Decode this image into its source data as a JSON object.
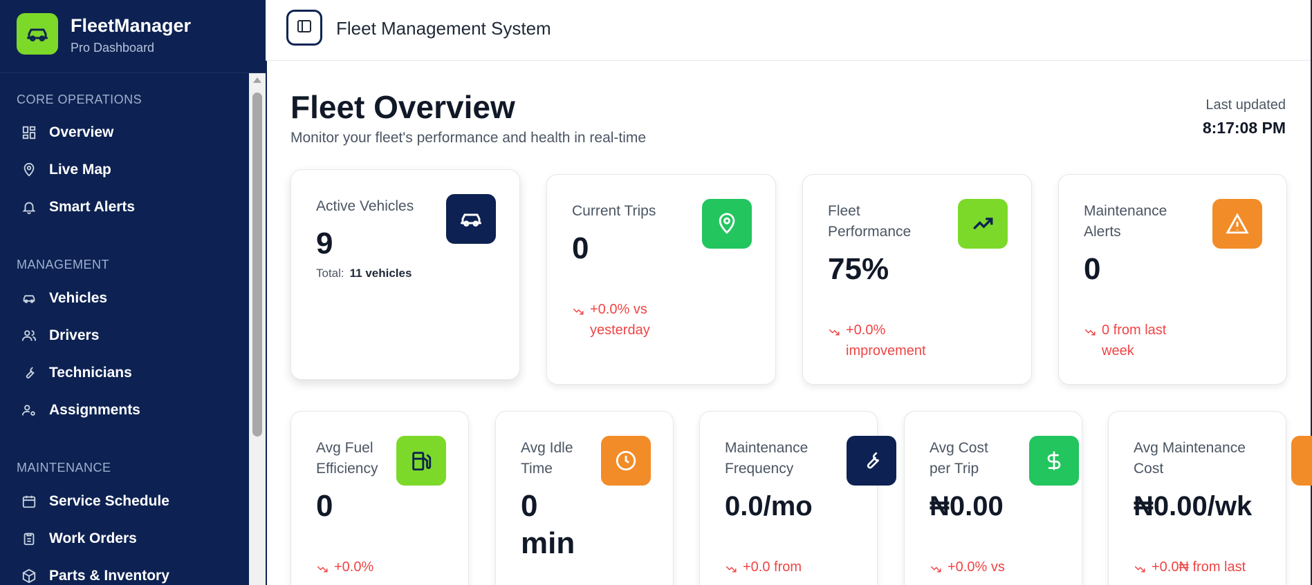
{
  "brand": {
    "name": "FleetManager",
    "subtitle": "Pro Dashboard",
    "logo_icon": "car-icon",
    "accent": "#7cd92a"
  },
  "sidebar": {
    "bg": "#0d2252",
    "sections": [
      {
        "title": "CORE OPERATIONS",
        "items": [
          {
            "label": "Overview",
            "icon": "grid-icon"
          },
          {
            "label": "Live Map",
            "icon": "map-pin-icon"
          },
          {
            "label": "Smart Alerts",
            "icon": "bell-icon"
          }
        ]
      },
      {
        "title": "MANAGEMENT",
        "items": [
          {
            "label": "Vehicles",
            "icon": "car-icon"
          },
          {
            "label": "Drivers",
            "icon": "users-icon"
          },
          {
            "label": "Technicians",
            "icon": "wrench-icon"
          },
          {
            "label": "Assignments",
            "icon": "user-cog-icon"
          }
        ]
      },
      {
        "title": "MAINTENANCE",
        "items": [
          {
            "label": "Service Schedule",
            "icon": "calendar-icon"
          },
          {
            "label": "Work Orders",
            "icon": "clipboard-icon"
          },
          {
            "label": "Parts & Inventory",
            "icon": "box-icon"
          }
        ]
      }
    ]
  },
  "header": {
    "title": "Fleet Management System",
    "toggle_icon": "sidebar-toggle-icon"
  },
  "main": {
    "title": "Fleet Overview",
    "subtitle": "Monitor your fleet's performance and health in real-time",
    "last_updated_label": "Last updated",
    "last_updated_time": "8:17:08 PM"
  },
  "stats_row1": [
    {
      "label": "Active Vehicles",
      "value": "9",
      "total_label": "Total:",
      "total_value": "11 vehicles",
      "icon": "car-icon",
      "color": "#0d2252"
    },
    {
      "label": "Current Trips",
      "value": "0",
      "trend": "+0.0% vs yesterday",
      "icon": "map-pin-icon",
      "color": "#22c55e"
    },
    {
      "label": "Fleet Performance",
      "value": "75%",
      "trend": "+0.0% improvement",
      "icon": "trending-up-icon",
      "color": "#7cd92a"
    },
    {
      "label": "Maintenance Alerts",
      "value": "0",
      "trend": "0 from last week",
      "icon": "warning-icon",
      "color": "#f28c28"
    }
  ],
  "stats_row2": [
    {
      "label": "Avg Fuel Efficiency",
      "value": "0",
      "trend": "+0.0%",
      "icon": "fuel-icon",
      "color": "#7cd92a"
    },
    {
      "label": "Avg Idle Time",
      "value": "0 min",
      "icon": "clock-icon",
      "color": "#f28c28"
    },
    {
      "label": "Maintenance Frequency",
      "value": "0.0/mo",
      "trend": "+0.0 from",
      "icon": "wrench-icon",
      "color": "#0d2252"
    },
    {
      "label": "Avg Cost per Trip",
      "value": "₦0.00",
      "trend": "+0.0% vs",
      "icon": "dollar-icon",
      "color": "#22c55e"
    },
    {
      "label": "Avg Maintenance Cost",
      "value": "₦0.00/wk",
      "trend": "+0.0₦ from last",
      "icon": "tool-icon",
      "color": "#f28c28"
    }
  ],
  "colors": {
    "trend_negative": "#ef4444",
    "text_dark": "#111827",
    "text_muted": "#4b5563"
  }
}
